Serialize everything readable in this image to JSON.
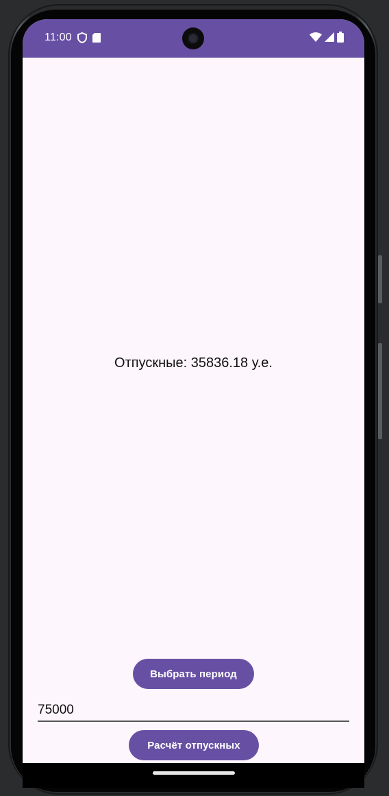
{
  "status_bar": {
    "time": "11:00",
    "background_color": "#6750a4",
    "left_icons": [
      "shield-icon",
      "sd-card-icon"
    ],
    "right_icons": [
      "wifi-icon",
      "cellular-signal-icon",
      "battery-icon"
    ]
  },
  "main": {
    "result_text": "Отпускные: 35836.18 у.е.",
    "select_period_button_label": "Выбрать период",
    "amount_field_value": "75000",
    "calculate_button_label": "Расчёт отпускных"
  },
  "colors": {
    "accent": "#6750a4",
    "screen_background": "#fdf6fc"
  }
}
